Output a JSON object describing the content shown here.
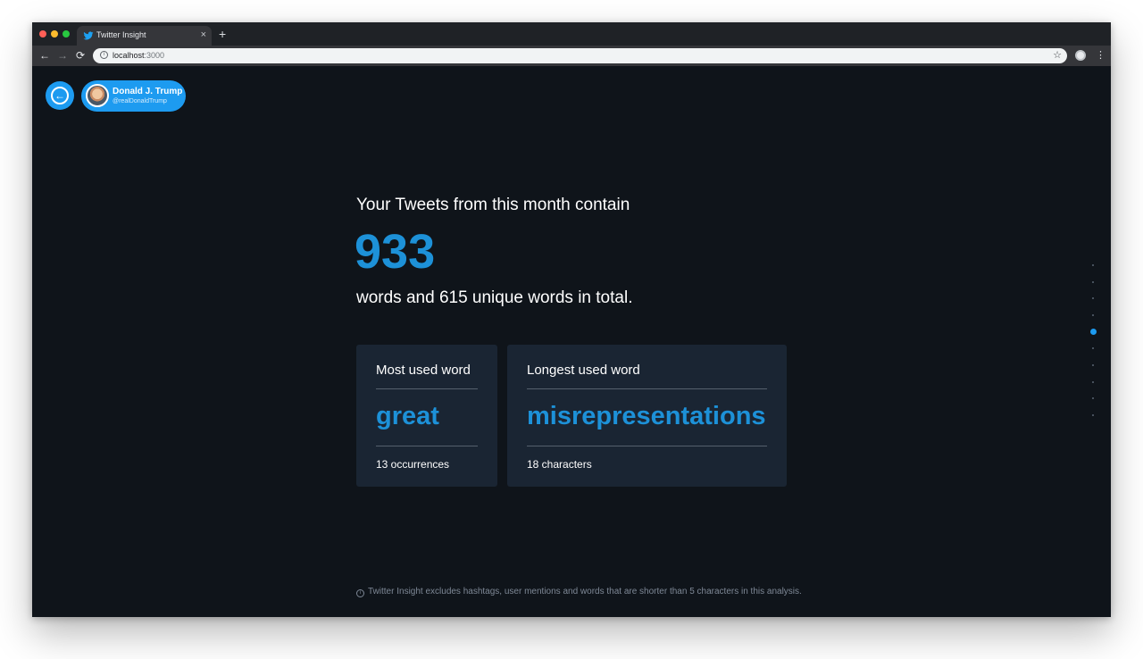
{
  "browser": {
    "tab_title": "Twitter Insight",
    "tab_close": "×",
    "new_tab": "+",
    "url_host": "localhost",
    "url_port": ":3000",
    "back": "←",
    "forward": "→",
    "reload": "⟳",
    "star": "☆",
    "menu": "⋮",
    "info": "i"
  },
  "header": {
    "back_glyph": "←",
    "user_name": "Donald J. Trump",
    "user_handle": "@realDonaldTrump"
  },
  "main": {
    "intro": "Your Tweets from this month contain",
    "word_count": "933",
    "summary": "words and 615 unique words in total."
  },
  "cards": [
    {
      "title": "Most used word",
      "word": "great",
      "detail": "13 occurrences"
    },
    {
      "title": "Longest used word",
      "word": "misrepresentations",
      "detail": "18 characters"
    }
  ],
  "pagination": {
    "total": 10,
    "active_index": 4
  },
  "footer": {
    "icon": "i",
    "note": "Twitter Insight excludes hashtags, user mentions and words that are shorter than 5 characters in this analysis."
  },
  "colors": {
    "accent": "#1d9bf0",
    "number": "#1d91d8",
    "background": "#0f141a",
    "card": "#1a2533"
  },
  "icons": [
    "twitter-bird-icon",
    "back-arrow-icon",
    "info-icon",
    "star-icon",
    "menu-icon"
  ]
}
